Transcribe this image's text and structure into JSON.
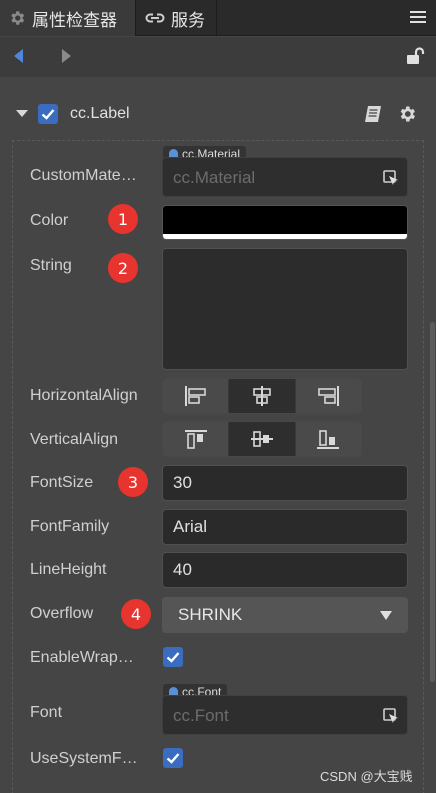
{
  "tabs": {
    "inspector_label": "属性检查器",
    "service_label": "服务"
  },
  "component": {
    "title": "cc.Label",
    "enabled": true
  },
  "properties": {
    "custom_material": {
      "label": "CustomMate…",
      "tag": "cc.Material",
      "placeholder": "cc.Material"
    },
    "color": {
      "label": "Color",
      "value": "#000000"
    },
    "string": {
      "label": "String",
      "value": ""
    },
    "horizontal_align": {
      "label": "HorizontalAlign",
      "selected": "left"
    },
    "vertical_align": {
      "label": "VerticalAlign",
      "selected": "top"
    },
    "font_size": {
      "label": "FontSize",
      "value": "30"
    },
    "font_family": {
      "label": "FontFamily",
      "value": "Arial"
    },
    "line_height": {
      "label": "LineHeight",
      "value": "40"
    },
    "overflow": {
      "label": "Overflow",
      "value": "SHRINK"
    },
    "enable_wrap": {
      "label": "EnableWrap…",
      "checked": true
    },
    "font": {
      "label": "Font",
      "tag": "cc.Font",
      "placeholder": "cc.Font"
    },
    "use_system_font": {
      "label": "UseSystemF…",
      "checked": true
    }
  },
  "badges": {
    "b1": "1",
    "b2": "2",
    "b3": "3",
    "b4": "4"
  },
  "watermark": "CSDN @大宝贱",
  "colors": {
    "badge": "#e8342e",
    "checkbox": "#3a6cc0",
    "panel_bg": "#454545"
  },
  "icons": [
    "gear-icon",
    "link-icon",
    "menu-icon",
    "back-arrow-icon",
    "forward-arrow-icon",
    "unlock-icon",
    "collapse-caret-icon",
    "book-icon",
    "settings-gear-icon",
    "pick-node-icon",
    "dropdown-arrow-icon"
  ]
}
